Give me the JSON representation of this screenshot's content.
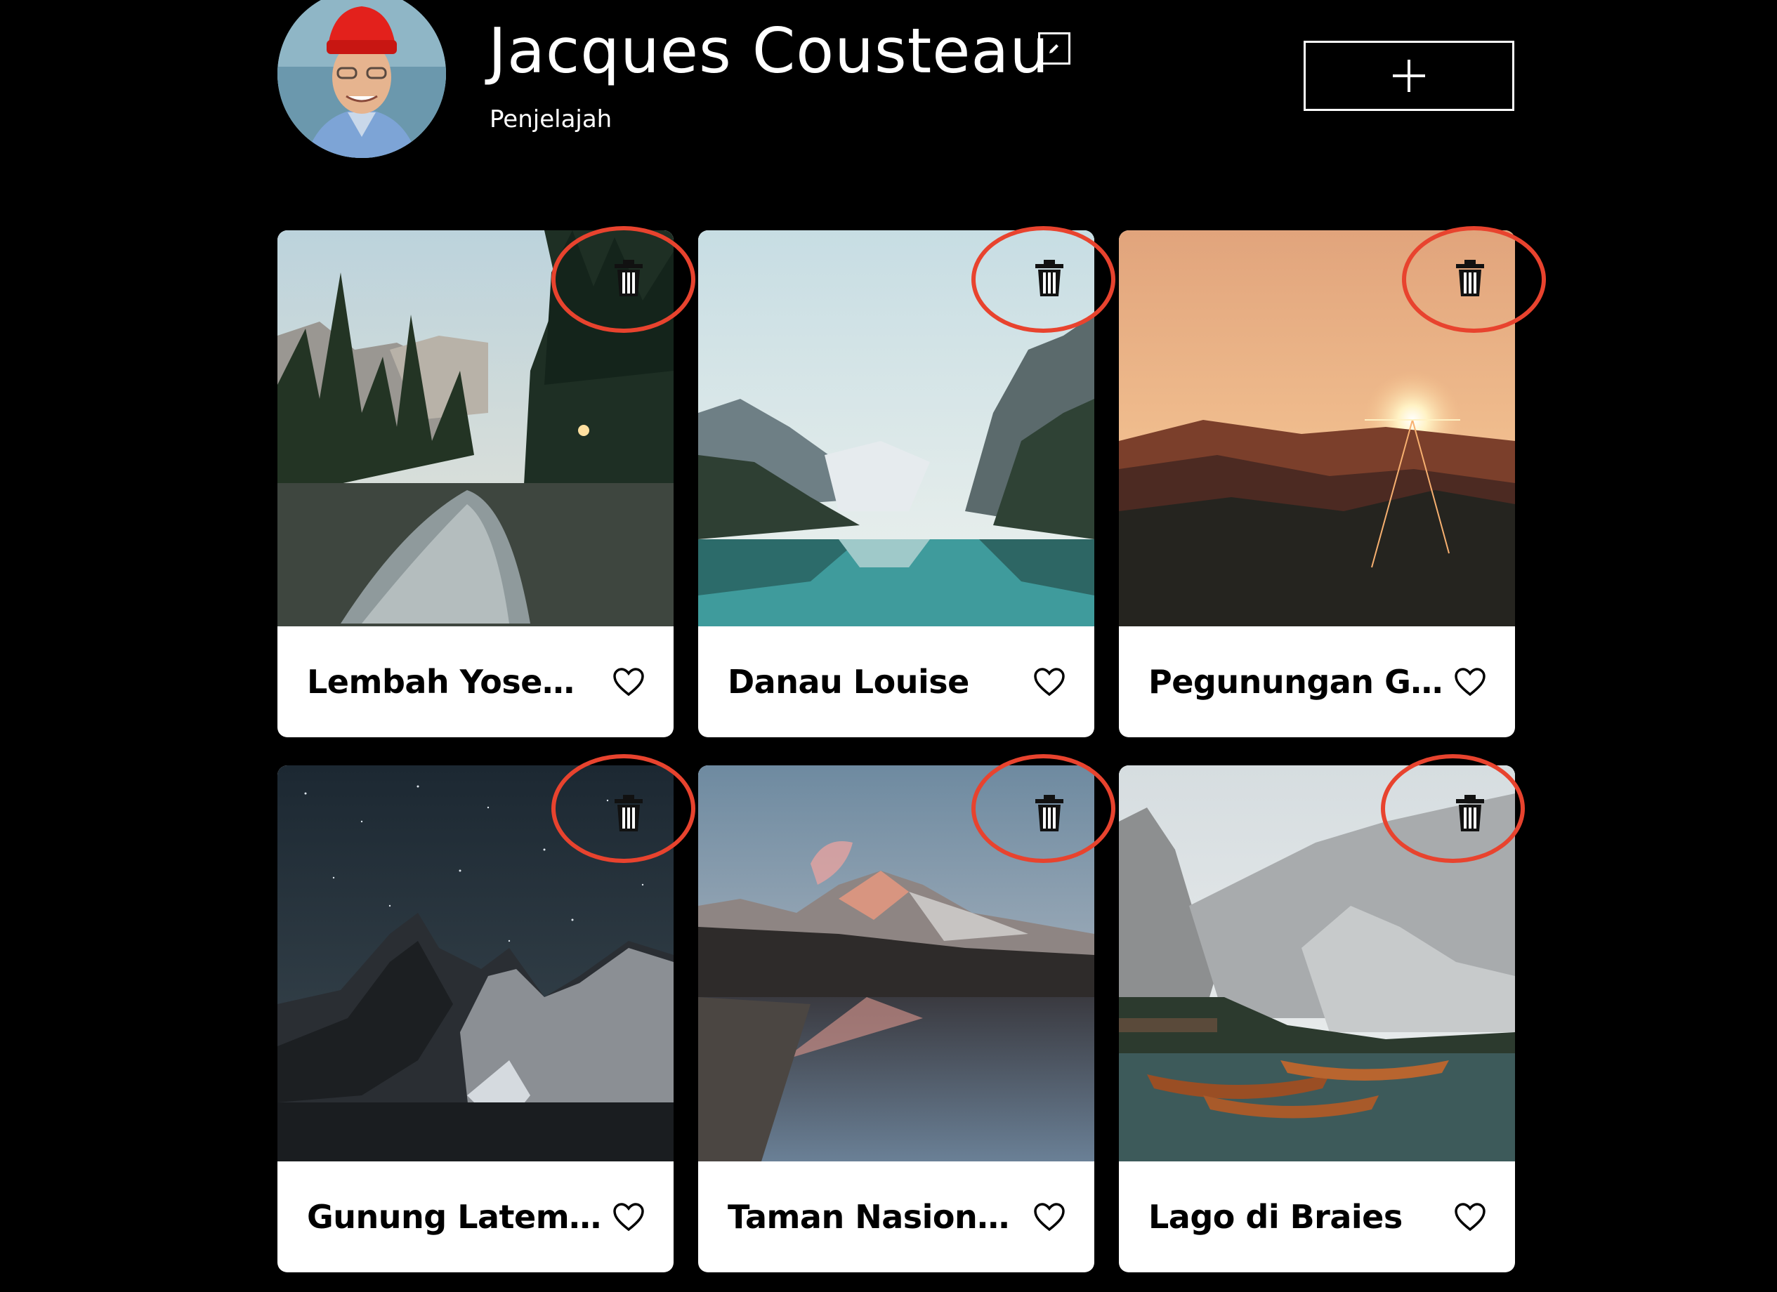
{
  "profile": {
    "name": "Jacques Cousteau",
    "job": "Penjelajah",
    "edit_icon": "pencil-icon",
    "add_icon": "plus-icon"
  },
  "cards": [
    {
      "title": "Lembah Yosemite",
      "liked": false
    },
    {
      "title": "Danau Louise",
      "liked": false
    },
    {
      "title": "Pegunungan Gundul",
      "liked": false
    },
    {
      "title": "Gunung Latemar",
      "liked": false
    },
    {
      "title": "Taman Nasional Vanoise",
      "liked": false
    },
    {
      "title": "Lago di Braies",
      "liked": false
    }
  ],
  "colors": {
    "background": "#000000",
    "card": "#ffffff",
    "highlight": "#e8432e"
  }
}
